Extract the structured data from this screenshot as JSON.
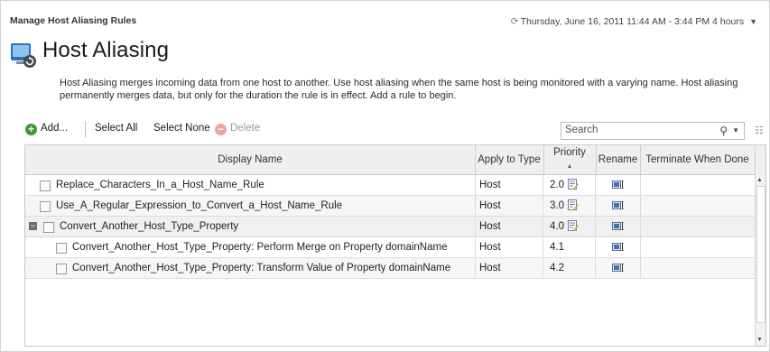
{
  "header": {
    "section_title": "Manage Host Aliasing Rules",
    "time_range": "Thursday, June 16, 2011 11:44 AM - 3:44 PM 4 hours"
  },
  "page": {
    "heading": "Host Aliasing",
    "icon": "host-aliasing-icon",
    "description": "Host Aliasing merges incoming data from one host to another. Use host aliasing when the same host is being monitored with a varying name. Host aliasing permanently merges data, but only for the duration the rule is in effect. Add a rule to begin."
  },
  "toolbar": {
    "add_label": "Add...",
    "select_all_label": "Select All",
    "select_none_label": "Select None",
    "delete_label": "Delete",
    "search_placeholder": "Search"
  },
  "table": {
    "columns": {
      "display_name": "Display Name",
      "apply_to_type": "Apply to Type",
      "priority": "Priority",
      "rename": "Rename",
      "terminate": "Terminate When Done"
    },
    "rows": [
      {
        "name": "Replace_Characters_In_a_Host_Name_Rule",
        "type": "Host",
        "priority": "2.0"
      },
      {
        "name": "Use_A_Regular_Expression_to_Convert_a_Host_Name_Rule",
        "type": "Host",
        "priority": "3.0"
      },
      {
        "name": "Convert_Another_Host_Type_Property",
        "type": "Host",
        "priority": "4.0"
      },
      {
        "name": "Convert_Another_Host_Type_Property: Perform Merge on Property domainName",
        "type": "Host",
        "priority": "4.1"
      },
      {
        "name": "Convert_Another_Host_Type_Property: Transform Value of Property domainName",
        "type": "Host",
        "priority": "4.2"
      }
    ]
  }
}
